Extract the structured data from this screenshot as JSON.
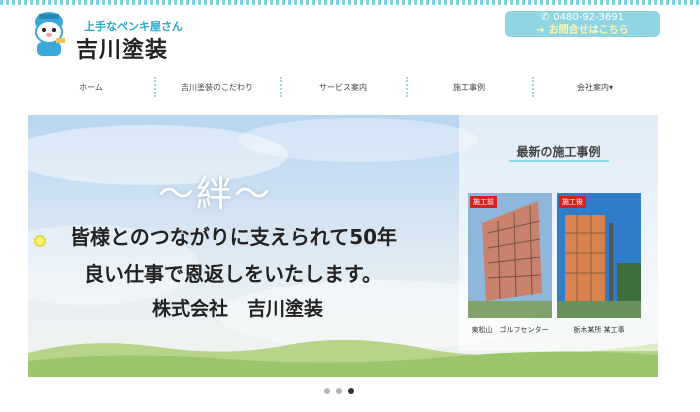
{
  "header": {
    "tagline": "上手なペンキ屋さん",
    "company_name": "吉川塗装",
    "phone": "0480-92-3691",
    "contact_link": "お問合せはこちら"
  },
  "nav": {
    "items": [
      {
        "label": "ホーム"
      },
      {
        "label": "吉川塗装のこだわり"
      },
      {
        "label": "サービス案内"
      },
      {
        "label": "施工事例"
      },
      {
        "label": "会社案内▾"
      }
    ]
  },
  "hero": {
    "heading": "〜絆〜",
    "line1": "皆様とのつながりに支えられて50年",
    "line2": "良い仕事で恩返しをいたします。",
    "line3": "株式会社　吉川塗装",
    "panel": {
      "title": "最新の施工事例",
      "cases": [
        {
          "badge": "施工前",
          "caption": "東松山　ゴルフセンター"
        },
        {
          "badge": "施工後",
          "caption": "栃木某所 某工事"
        }
      ]
    }
  },
  "slider": {
    "dots": 3,
    "active_index": 2
  },
  "colors": {
    "accent": "#8fd6e2",
    "contact_text": "#fff6b3",
    "badge": "#d32222"
  }
}
